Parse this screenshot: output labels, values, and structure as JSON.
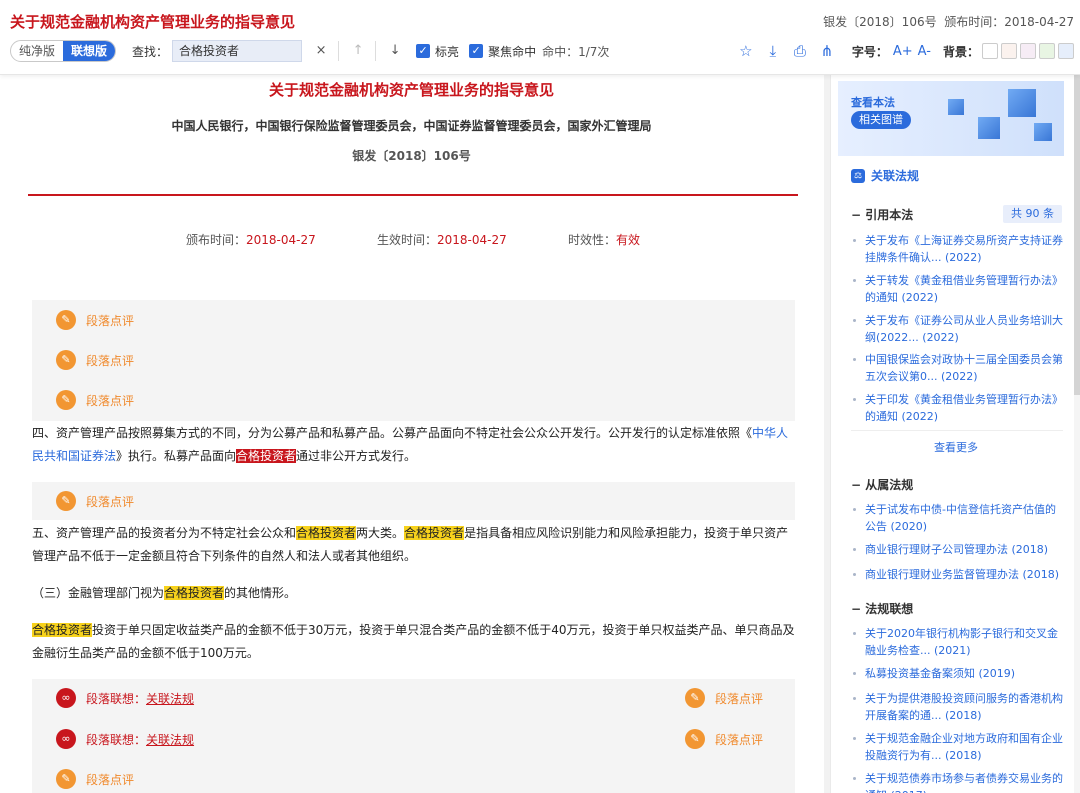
{
  "header": {
    "title": "关于规范金融机构资产管理业务的指导意见",
    "doc_no": "银发〔2018〕106号",
    "issue_label": "颁布时间：",
    "issue_date": "2018-04-27"
  },
  "toolbar": {
    "mode_plain": "纯净版",
    "mode_linked": "联想版",
    "find_label": "查找：",
    "find_value": "合格投资者",
    "clear_icon": "×",
    "up_icon": "↑",
    "down_icon": "↓",
    "opt_mark": "标亮",
    "opt_focus": "聚焦命中",
    "hit_label": "命中：1/7次",
    "font_size_label": "字号：",
    "font_up": "A+",
    "font_down": "A-",
    "bg_label": "背景："
  },
  "icons": {
    "favorite": "☆",
    "download": "⤓",
    "print": "⎙",
    "share": "⋔"
  },
  "bg_swatches": [
    "#ffffff",
    "#fbf2ee",
    "#f6ecf5",
    "#e8f5e3",
    "#e6eefb"
  ],
  "article": {
    "title": "关于规范金融机构资产管理业务的指导意见",
    "issuers": "中国人民银行，中国银行保险监督管理委员会，中国证券监督管理委员会，国家外汇管理局",
    "doc_no": "银发〔2018〕106号",
    "issue_label": "颁布时间：",
    "issue_date": "2018-04-27",
    "effect_label": "生效时间：",
    "effect_date": "2018-04-27",
    "status_label": "时效性：",
    "status": "有效"
  },
  "comment_label": "段落点评",
  "link_label": "段落联想：",
  "link_value": "关联法规",
  "paragraphs": {
    "p4_a": "四、资产管理产品按照募集方式的不同，分为公募产品和私募产品。公募产品面向不特定社会公众公开发行。公开发行的认定标准依照《",
    "p4_link": "中华人民共和国证券法",
    "p4_b": "》执行。私募产品面向",
    "p4_hl": "合格投资者",
    "p4_c": "通过非公开方式发行。",
    "p5_a": "五、资产管理产品的投资者分为不特定社会公众和",
    "p5_hl1": "合格投资者",
    "p5_b": "两大类。",
    "p5_hl2": "合格投资者",
    "p5_c": "是指具备相应风险识别能力和风险承担能力，投资于单只资产管理产品不低于一定金额且符合下列条件的自然人和法人或者其他组织。",
    "p6_a": "（三）金融管理部门视为",
    "p6_hl": "合格投资者",
    "p6_b": "的其他情形。",
    "p7_hl": "合格投资者",
    "p7_a": "投资于单只固定收益类产品的金额不低于30万元，投资于单只混合类产品的金额不低于40万元，投资于单只权益类产品、单只商品及金融衍生品类产品的金额不低于100万元。"
  },
  "sidebar": {
    "banner_title": "查看本法",
    "banner_btn": "相关图谱",
    "section_title": "关联法规",
    "cite_group": "引用本法",
    "cite_count": "共 90 条",
    "cite_items": [
      "关于发布《上海证券交易所资产支持证券挂牌条件确认... (2022)",
      "关于转发《黄金租借业务管理暂行办法》的通知 (2022)",
      "关于发布《证券公司从业人员业务培训大纲(2022... (2022)",
      "中国银保监会对政协十三届全国委员会第五次会议第0... (2022)",
      "关于印发《黄金租借业务管理暂行办法》的通知 (2022)"
    ],
    "more": "查看更多",
    "sub_group": "从属法规",
    "sub_items": [
      "关于试发布中债-中信登信托资产估值的公告 (2020)",
      "商业银行理财子公司管理办法 (2018)",
      "商业银行理财业务监督管理办法 (2018)"
    ],
    "assoc_group": "法规联想",
    "assoc_items": [
      "关于2020年银行机构影子银行和交叉金融业务检查... (2021)",
      "私募投资基金备案须知 (2019)",
      "关于为提供港股投资顾问服务的香港机构开展备案的通... (2018)",
      "关于规范金融企业对地方政府和国有企业投融资行为有... (2018)",
      "关于规范债券市场参与者债券交易业务的通知 (2017)"
    ]
  }
}
